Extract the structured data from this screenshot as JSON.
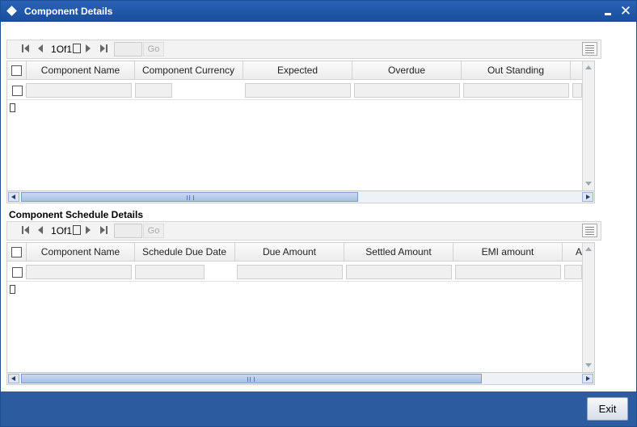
{
  "window": {
    "title": "Component Details",
    "close_glyph": "✕"
  },
  "grid1": {
    "pagination": {
      "current": "1",
      "of_label": "Of",
      "total": "1",
      "go_label": "Go"
    },
    "columns": [
      "Component Name",
      "Component Currency",
      "Expected",
      "Overdue",
      "Out Standing"
    ]
  },
  "grid2": {
    "label": "Component Schedule Details",
    "pagination": {
      "current": "1",
      "of_label": "Of",
      "total": "1",
      "go_label": "Go"
    },
    "columns": [
      "Component Name",
      "Schedule Due Date",
      "Due Amount",
      "Settled Amount",
      "EMI amount",
      "A"
    ]
  },
  "footer": {
    "exit_label": "Exit"
  },
  "colors": {
    "titlebar": "#1a4d9d",
    "footer": "#2d5b9f"
  }
}
